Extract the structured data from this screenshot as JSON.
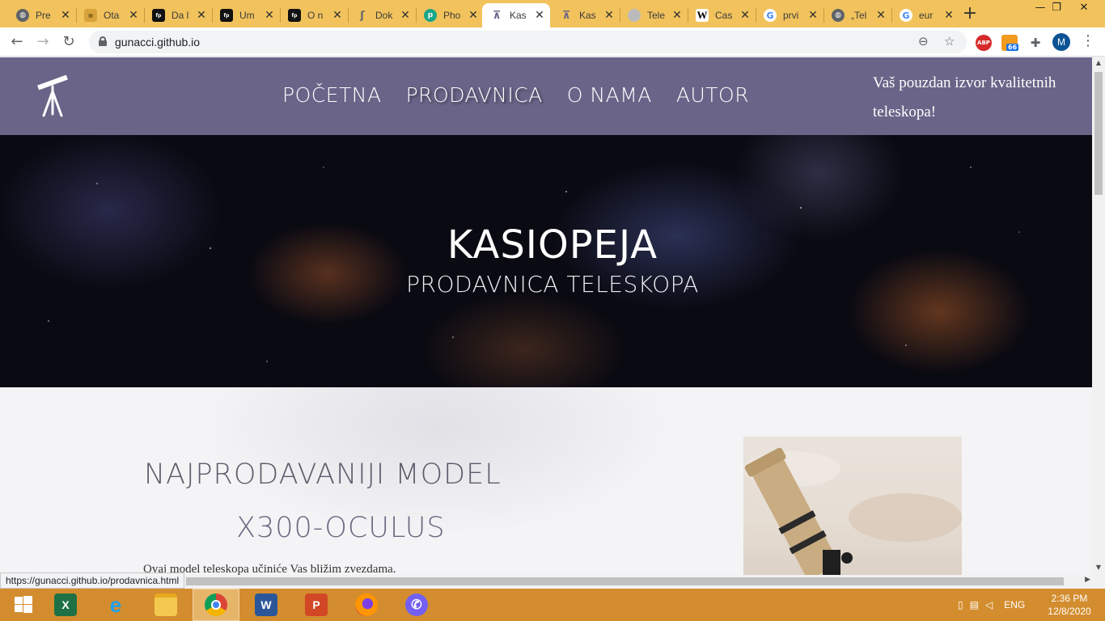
{
  "browser": {
    "tabs": [
      {
        "label": "Pre",
        "favicon": "globe-icon",
        "active": false
      },
      {
        "label": "Ota",
        "favicon": "site-icon",
        "active": false
      },
      {
        "label": "Da l",
        "favicon": "site-icon",
        "active": false
      },
      {
        "label": "Um",
        "favicon": "site-icon",
        "active": false
      },
      {
        "label": "O n",
        "favicon": "site-icon",
        "active": false
      },
      {
        "label": "Dok",
        "favicon": "site-icon",
        "active": false
      },
      {
        "label": "Pho",
        "favicon": "site-icon",
        "active": false
      },
      {
        "label": "Kas",
        "favicon": "telescope-icon",
        "active": true
      },
      {
        "label": "Kas",
        "favicon": "telescope-icon",
        "active": false
      },
      {
        "label": "Tele",
        "favicon": "site-icon",
        "active": false
      },
      {
        "label": "Cas",
        "favicon": "wikipedia-icon",
        "active": false
      },
      {
        "label": "prvi",
        "favicon": "google-icon",
        "active": false
      },
      {
        "label": "„Tel",
        "favicon": "globe-icon",
        "active": false
      },
      {
        "label": "eur",
        "favicon": "google-icon",
        "active": false
      }
    ],
    "new_tab": "+",
    "url": "gunacci.github.io",
    "profile_initial": "M",
    "rss_badge": "66",
    "abp_label": "ABP",
    "status_url": "https://gunacci.github.io/prodavnica.html"
  },
  "site": {
    "menu": [
      {
        "label": "POČETNA",
        "current": false
      },
      {
        "label": "PRODAVNICA",
        "current": true
      },
      {
        "label": "O NAMA",
        "current": false
      },
      {
        "label": "AUTOR",
        "current": false
      }
    ],
    "tagline": "Vaš pouzdan izvor kvalitetnih teleskopa!",
    "hero_title": "KASIOPEJA",
    "hero_subtitle": "PRODAVNICA TELESKOPA",
    "section_heading": "NAJPRODAVANIJI MODEL",
    "model_name": "X300-OCULUS",
    "model_description": "Ovaj model teleskopa učiniće Vas bližim zvezdama."
  },
  "taskbar": {
    "apps": [
      "Excel",
      "Internet Explorer",
      "File Explorer",
      "Chrome",
      "Word",
      "PowerPoint",
      "Firefox",
      "Viber"
    ],
    "language": "ENG",
    "time": "2:36 PM",
    "date": "12/8/2020"
  },
  "colors": {
    "tabstrip": "#f2c35c",
    "site_nav": "#6a6488",
    "taskbar": "#d38d2e"
  }
}
